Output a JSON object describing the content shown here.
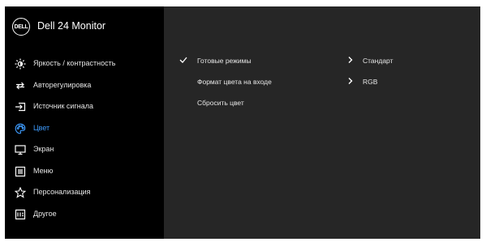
{
  "header": {
    "logo_text": "DELL",
    "title": "Dell 24 Monitor"
  },
  "sidebar": {
    "items": [
      {
        "label": "Яркость / контрастность",
        "icon": "brightness-icon"
      },
      {
        "label": "Авторегулировка",
        "icon": "auto-adjust-icon"
      },
      {
        "label": "Источник сигнала",
        "icon": "input-source-icon"
      },
      {
        "label": "Цвет",
        "icon": "color-palette-icon",
        "active": true
      },
      {
        "label": "Экран",
        "icon": "display-icon"
      },
      {
        "label": "Меню",
        "icon": "menu-icon"
      },
      {
        "label": "Персонализация",
        "icon": "star-icon"
      },
      {
        "label": "Другое",
        "icon": "other-icon"
      }
    ]
  },
  "main": {
    "rows": [
      {
        "label": "Готовые режимы",
        "value": "Стандарт",
        "checked": true
      },
      {
        "label": "Формат цвета на входе",
        "value": "RGB",
        "checked": false
      },
      {
        "label": "Сбросить цвет",
        "value": "",
        "checked": false
      }
    ]
  },
  "colors": {
    "accent": "#3e9cff",
    "sidebar_bg": "#000000",
    "main_bg": "#262626"
  }
}
